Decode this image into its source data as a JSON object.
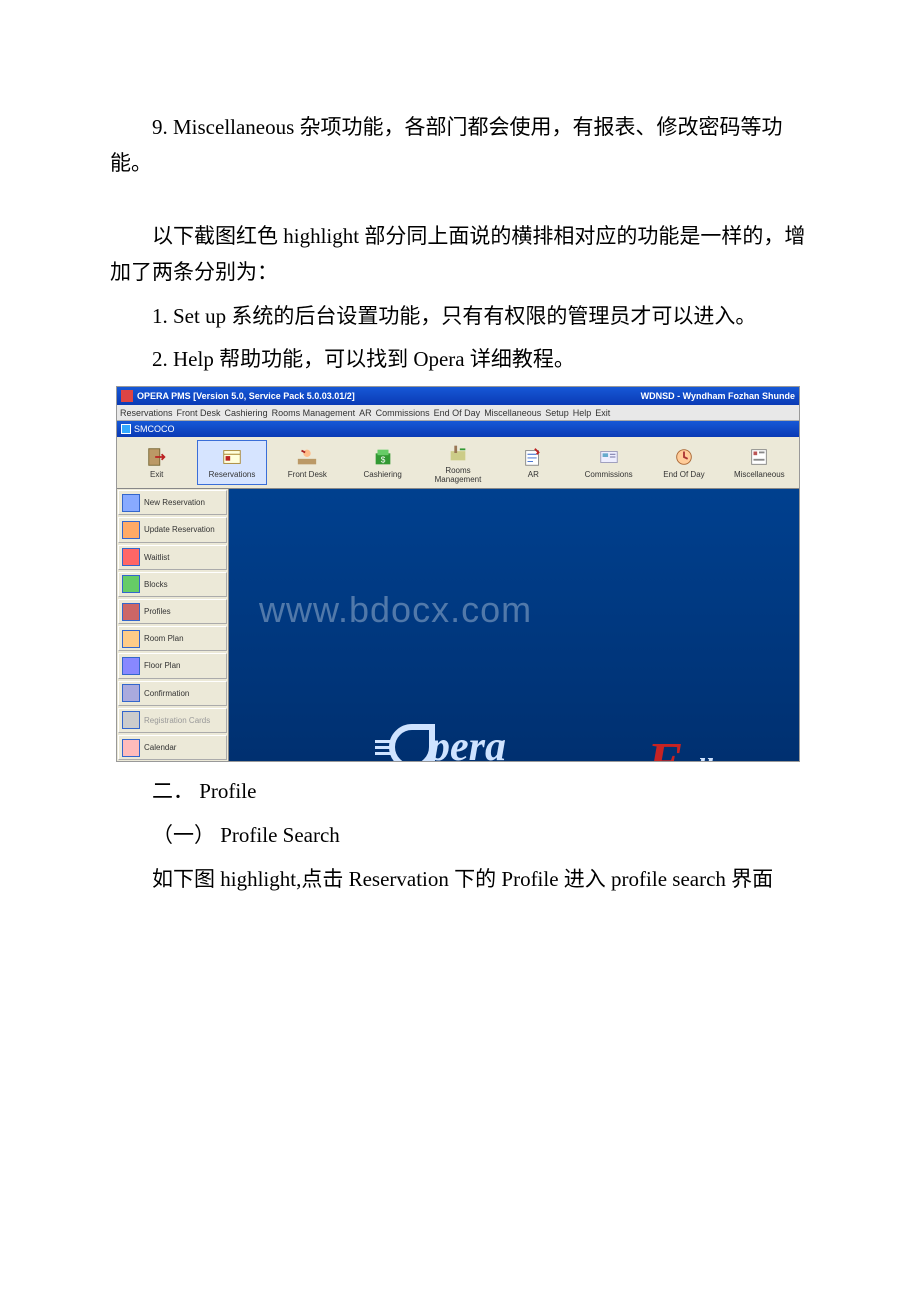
{
  "paragraphs": {
    "p1": "9. Miscellaneous 杂项功能，各部门都会使用，有报表、修改密码等功能。",
    "p2": "以下截图红色 highlight 部分同上面说的横排相对应的功能是一样的，增加了两条分别为：",
    "p3": "1. Set up 系统的后台设置功能，只有有权限的管理员才可以进入。",
    "p4": "2. Help 帮助功能，可以找到 Opera 详细教程。",
    "p5": "二． Profile",
    "p6": "（一） Profile Search",
    "p7": "如下图 highlight,点击 Reservation 下的 Profile 进入 profile search 界面"
  },
  "screenshot": {
    "title_left": "OPERA PMS [Version 5.0, Service Pack 5.0.03.01/2]",
    "title_right": "WDNSD - Wyndham Fozhan Shunde",
    "menus": [
      "Reservations",
      "Front Desk",
      "Cashiering",
      "Rooms Management",
      "AR",
      "Commissions",
      "End Of Day",
      "Miscellaneous",
      "Setup",
      "Help",
      "Exit"
    ],
    "user": "SMCOCO",
    "toolbar": [
      {
        "label": "Exit",
        "icon": "exit",
        "sel": false
      },
      {
        "label": "Reservations",
        "icon": "resv",
        "sel": true
      },
      {
        "label": "Front Desk",
        "icon": "fdesk",
        "sel": false
      },
      {
        "label": "Cashiering",
        "icon": "cash",
        "sel": false
      },
      {
        "label": "Rooms Management",
        "icon": "rooms",
        "sel": false
      },
      {
        "label": "AR",
        "icon": "ar",
        "sel": false
      },
      {
        "label": "Commissions",
        "icon": "comm",
        "sel": false
      },
      {
        "label": "End Of Day",
        "icon": "eod",
        "sel": false
      },
      {
        "label": "Miscellaneous",
        "icon": "misc",
        "sel": false
      }
    ],
    "sidebar": [
      {
        "label": "New Reservation",
        "dim": false
      },
      {
        "label": "Update Reservation",
        "dim": false
      },
      {
        "label": "Waitlist",
        "dim": false
      },
      {
        "label": "Blocks",
        "dim": false
      },
      {
        "label": "Profiles",
        "dim": false
      },
      {
        "label": "Room Plan",
        "dim": false
      },
      {
        "label": "Floor Plan",
        "dim": false
      },
      {
        "label": "Confirmation",
        "dim": false
      },
      {
        "label": "Registration Cards",
        "dim": true
      },
      {
        "label": "Calendar",
        "dim": false
      }
    ],
    "watermark": "www.bdocx.com",
    "logo_text": "pera",
    "full_f": "F",
    "full_ull": "ull"
  }
}
